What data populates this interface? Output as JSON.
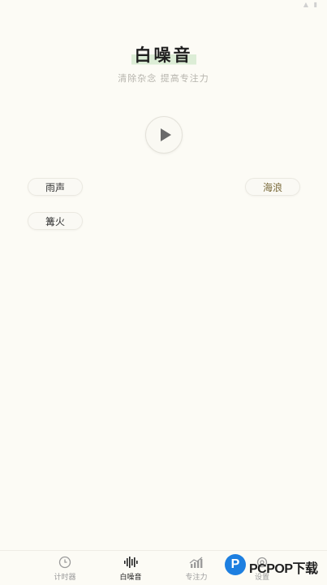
{
  "header": {
    "title": "白噪音",
    "subtitle": "清除杂念 提高专注力"
  },
  "player": {
    "play_icon": "play-icon"
  },
  "sounds": [
    {
      "label": "雨声"
    },
    {
      "label": "海浪"
    },
    {
      "label": "篝火"
    }
  ],
  "tab_bar": {
    "tabs": [
      {
        "label": "计时器",
        "icon": "clock-icon",
        "active": false
      },
      {
        "label": "白噪音",
        "icon": "soundwave-icon",
        "active": true
      },
      {
        "label": "专注力",
        "icon": "chart-icon",
        "active": false
      },
      {
        "label": "设置",
        "icon": "settings-icon",
        "active": false
      }
    ]
  },
  "watermark": {
    "text": "PCPOP下载"
  },
  "colors": {
    "background": "#fcfbf5",
    "title_highlight": "#dcedd6",
    "active_tab": "#222222",
    "inactive_tab": "#9b9b9b",
    "watermark_blue": "#1d7fe0"
  }
}
